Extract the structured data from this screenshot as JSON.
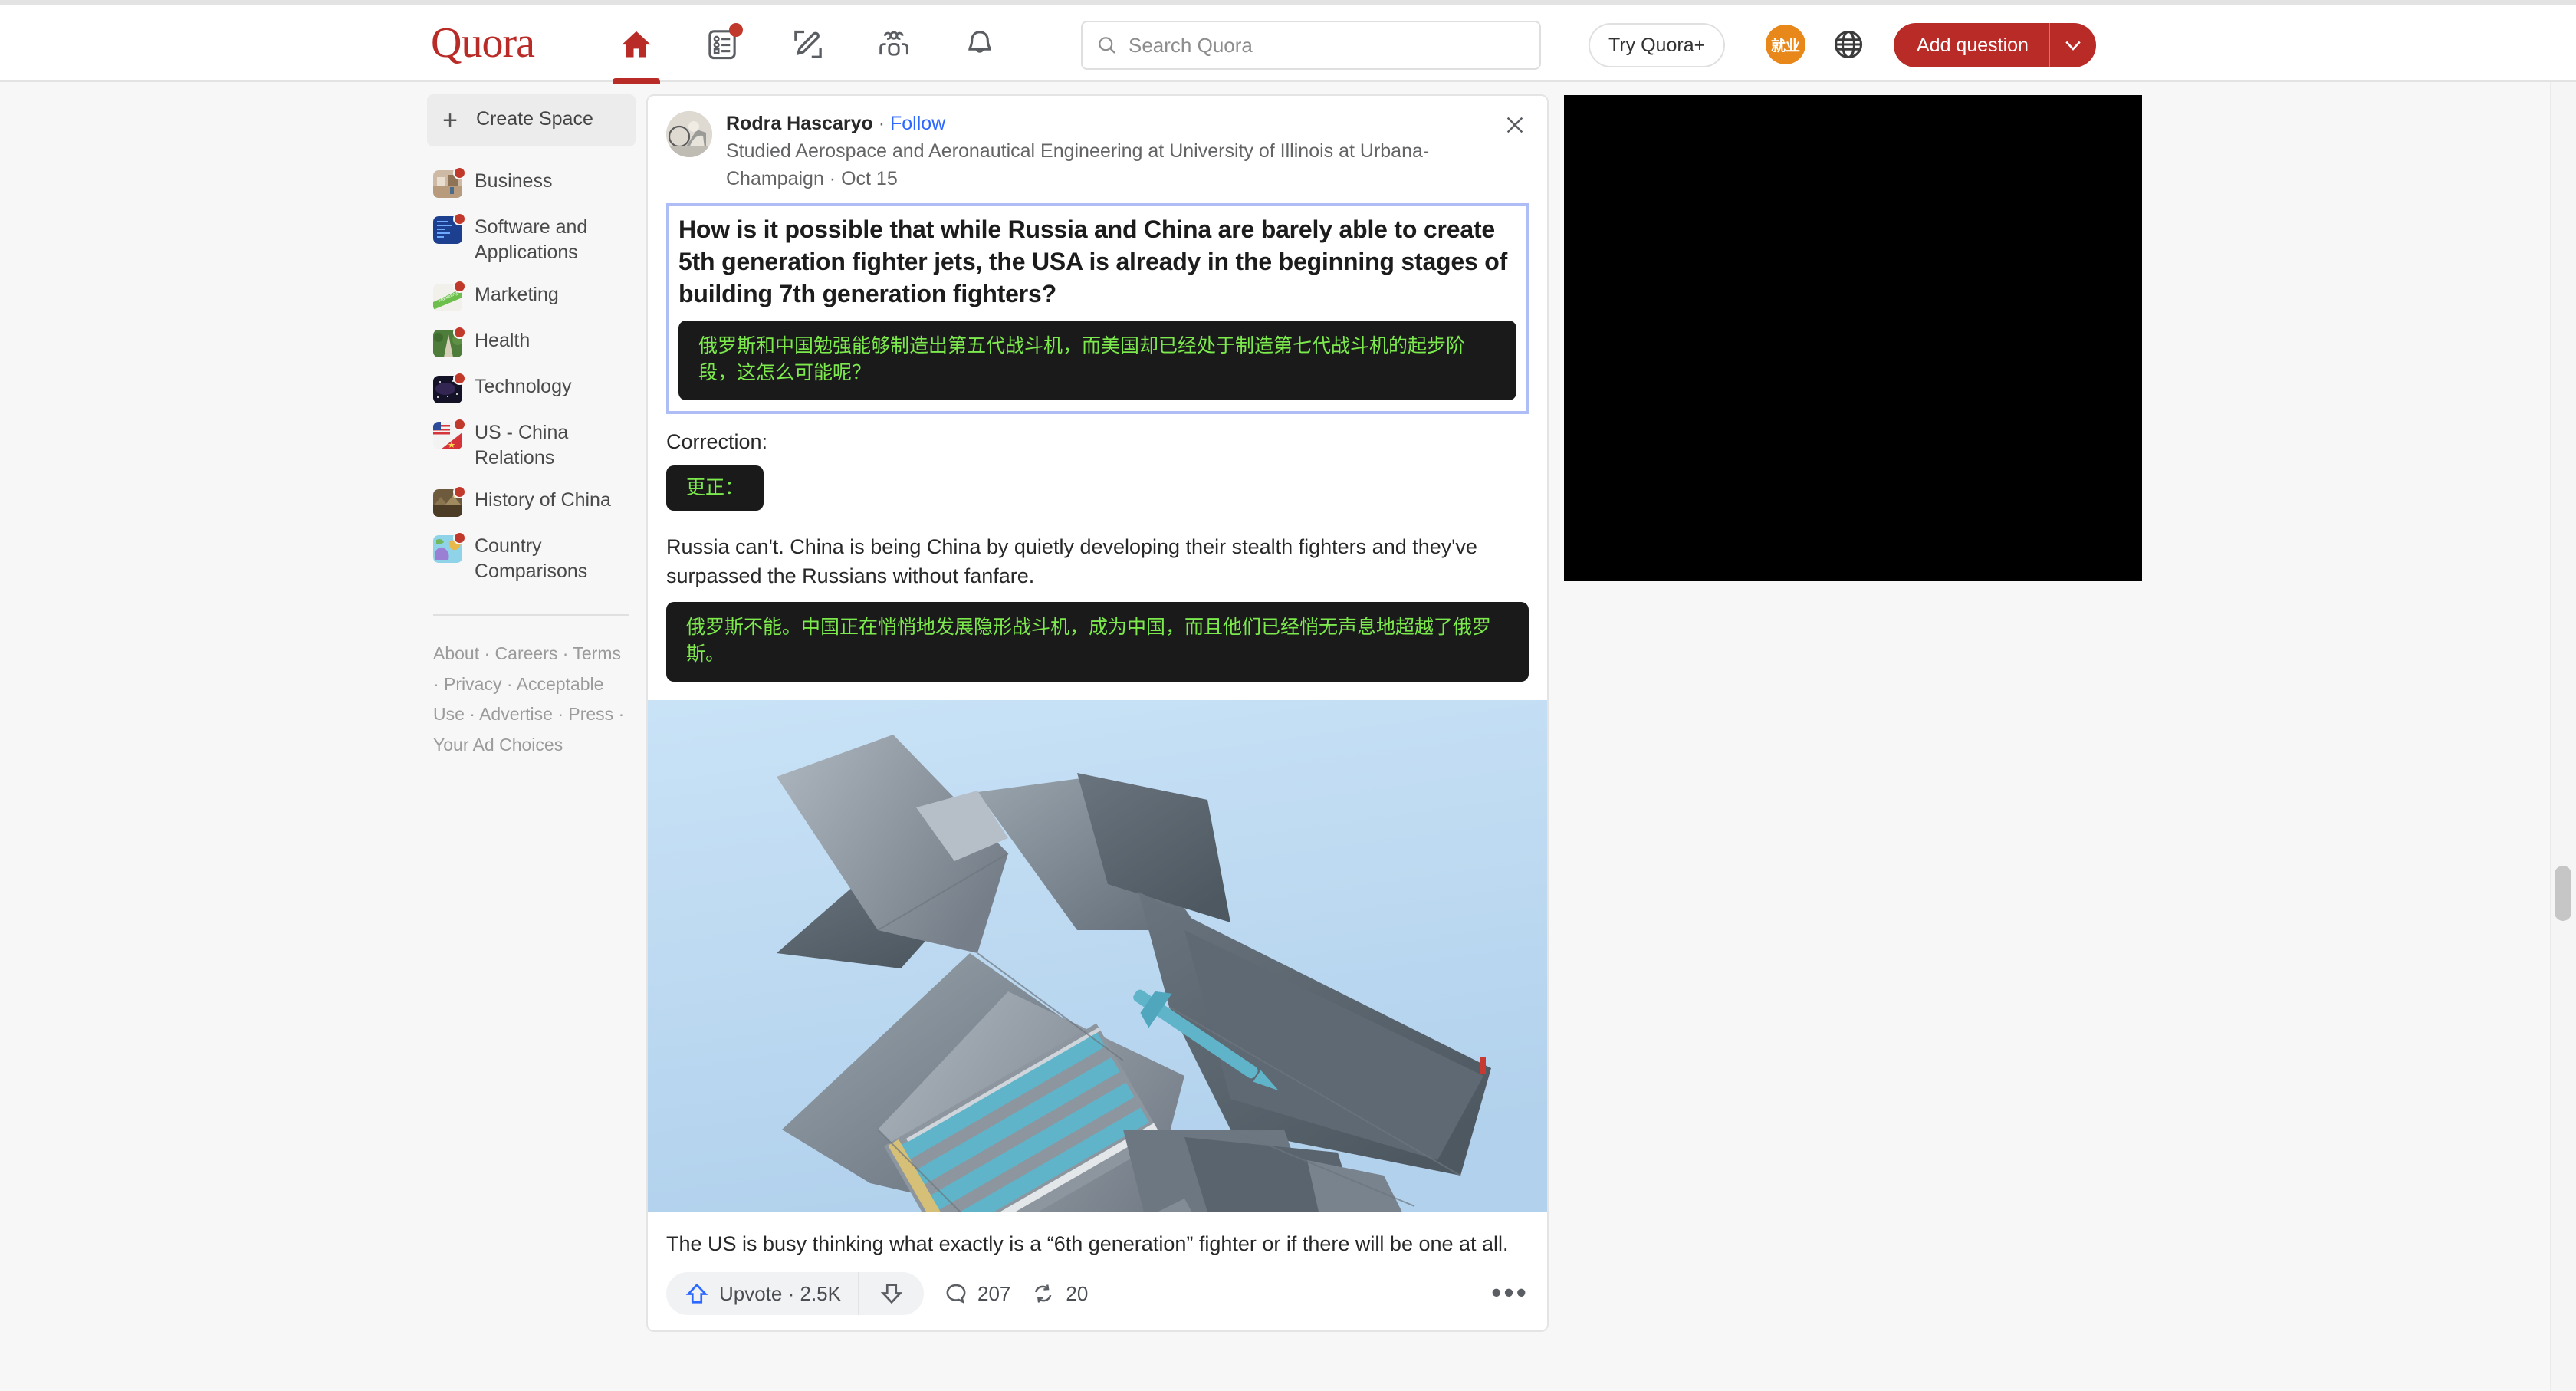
{
  "header": {
    "logo": "Quora",
    "nav": [
      {
        "name": "home-icon",
        "label": "Home",
        "active": true,
        "badge": false
      },
      {
        "name": "answers-icon",
        "label": "Answers",
        "active": false,
        "badge": true
      },
      {
        "name": "write-icon",
        "label": "Write",
        "active": false,
        "badge": false
      },
      {
        "name": "spaces-icon",
        "label": "Spaces",
        "active": false,
        "badge": false
      },
      {
        "name": "notifications-icon",
        "label": "Notifications",
        "active": false,
        "badge": false
      }
    ],
    "search": {
      "placeholder": "Search Quora",
      "value": ""
    },
    "try_quora_plus": "Try Quora+",
    "avatar_text": "就业",
    "add_question": "Add question",
    "accent_color": "#b92b27"
  },
  "sidebar": {
    "create_space": "Create Space",
    "spaces": [
      {
        "label": "Business"
      },
      {
        "label": "Software and Applications"
      },
      {
        "label": "Marketing"
      },
      {
        "label": "Health"
      },
      {
        "label": "Technology"
      },
      {
        "label": "US - China Relations"
      },
      {
        "label": "History of China"
      },
      {
        "label": "Country Comparisons"
      }
    ],
    "footer_links": "About · Careers · Terms · Privacy · Acceptable Use · Advertise · Press · Your Ad Choices"
  },
  "post": {
    "author": "Rodra Hascaryo",
    "separator": " · ",
    "follow": "Follow",
    "credential": "Studied Aerospace and Aeronautical Engineering at University of Illinois at Urbana-Champaign · Oct 15",
    "question_title": "How is it possible that while Russia and China are barely able to create 5th generation fighter jets, the USA is already in the beginning stages of building 7th generation fighters?",
    "question_translation": "俄罗斯和中国勉强能够制造出第五代战斗机，而美国却已经处于制造第七代战斗机的起步阶段，这怎么可能呢？",
    "correction_label": "Correction:",
    "correction_translation": "更正：",
    "body_paragraph": "Russia can't. China is being China by quietly developing their stealth fighters and they've surpassed the Russians without fanfare.",
    "body_translation": "俄罗斯不能。中国正在悄悄地发展隐形战斗机，成为中国，而且他们已经悄无声息地超越了俄罗斯。",
    "image_alt": "Chinese J-20 stealth fighter jet viewed from below with open weapon bays against a blue sky",
    "caption": "The US is busy thinking what exactly is a “6th generation” fighter or if there will be one at all.",
    "actions": {
      "upvote_label": "Upvote · 2.5K",
      "comment_count": "207",
      "share_count": "20",
      "more_label": "•••"
    },
    "highlight_border_color": "#aebdf5",
    "translation_bg": "#1a1a1a",
    "translation_fg": "#7ce94d"
  }
}
